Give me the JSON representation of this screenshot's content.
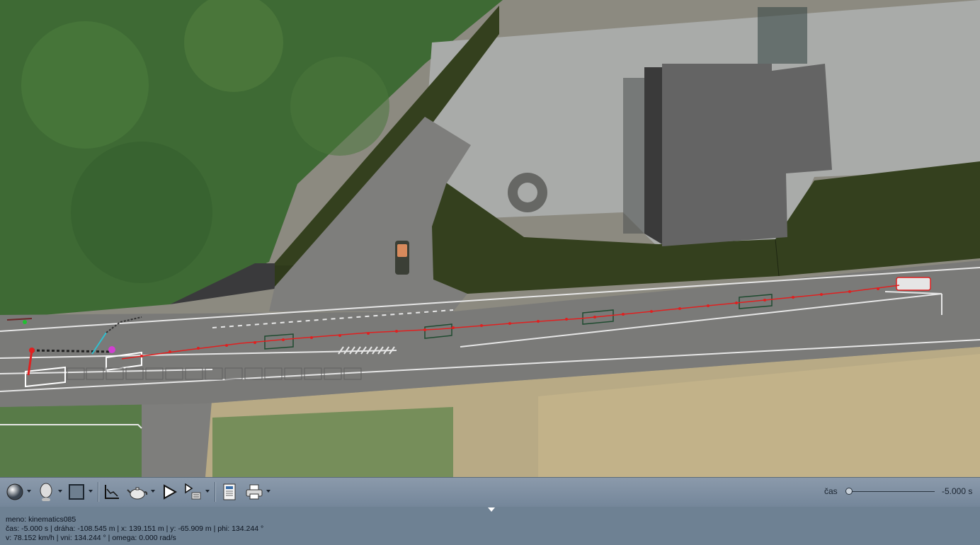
{
  "scene": {
    "object_name": "kinematics085",
    "colors": {
      "grass_block": "#34401e",
      "road": "#7d7d7b",
      "lane_marking": "#e8e8e8",
      "trajectory": "#e02020",
      "vehicle_box": "#2f5a3a",
      "building_roof": "#616161"
    }
  },
  "toolbar": {
    "buttons": [
      {
        "name": "render-mode-button",
        "icon": "sphere-icon"
      },
      {
        "name": "head-view-button",
        "icon": "head-icon"
      },
      {
        "name": "background-color-button",
        "icon": "square-icon"
      },
      {
        "name": "graph-button",
        "icon": "graph-icon"
      },
      {
        "name": "camera-button",
        "icon": "teapot-icon"
      },
      {
        "name": "play-button",
        "icon": "play-icon"
      },
      {
        "name": "step-button",
        "icon": "step-icon"
      },
      {
        "name": "report-button",
        "icon": "document-icon"
      },
      {
        "name": "print-button",
        "icon": "printer-icon"
      }
    ],
    "time_label": "čas",
    "time_value": "-5.000 s",
    "time_position": 0.0
  },
  "status": {
    "line1": "meno: kinematics085",
    "line2": "čas: -5.000 s | dráha: -108.545 m | x: 139.151 m | y: -65.909 m | phi: 134.244 °",
    "line3": "v: 78.152 km/h | vni: 134.244 ° | omega: 0.000 rad/s"
  }
}
